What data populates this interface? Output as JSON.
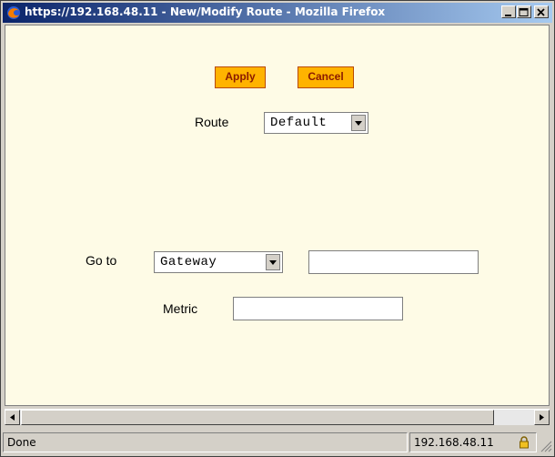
{
  "window": {
    "title": "https://192.168.48.11 - New/Modify Route - Mozilla Firefox"
  },
  "form": {
    "apply_label": "Apply",
    "cancel_label": "Cancel",
    "route_label": "Route",
    "route_value": "Default",
    "goto_label": "Go to",
    "goto_value": "Gateway",
    "goto_address_value": "",
    "metric_label": "Metric",
    "metric_value": ""
  },
  "status": {
    "text": "Done",
    "host": "192.168.48.11"
  },
  "colors": {
    "page_background": "#fefbe6",
    "button_fill": "#ffb300",
    "button_text": "#8b1a00",
    "titlebar_start": "#0a246a",
    "titlebar_end": "#a6caf0"
  },
  "icons": [
    "firefox-icon",
    "minimize-icon",
    "maximize-icon",
    "close-icon",
    "scroll-left-icon",
    "scroll-right-icon",
    "lock-icon",
    "resize-grip-icon"
  ]
}
